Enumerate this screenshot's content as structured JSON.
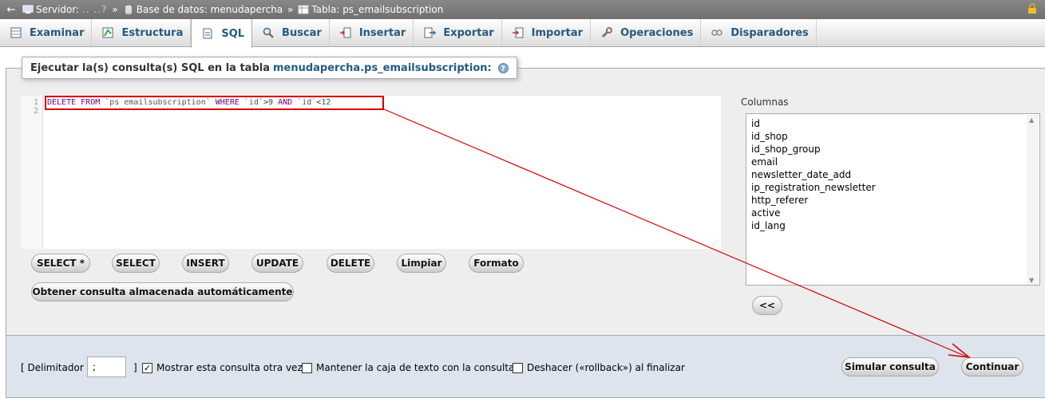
{
  "breadcrumb": {
    "server_label": "Servidor:",
    "server_name": ".. ..?",
    "database_label": "Base de datos: menudapercha",
    "table_label": "Tabla: ps_emailsubscription"
  },
  "tabs": [
    {
      "label": "Examinar",
      "icon": "browse-icon"
    },
    {
      "label": "Estructura",
      "icon": "structure-icon"
    },
    {
      "label": "SQL",
      "icon": "sql-icon",
      "active": true
    },
    {
      "label": "Buscar",
      "icon": "search-icon"
    },
    {
      "label": "Insertar",
      "icon": "insert-icon"
    },
    {
      "label": "Exportar",
      "icon": "export-icon"
    },
    {
      "label": "Importar",
      "icon": "import-icon"
    },
    {
      "label": "Operaciones",
      "icon": "wrench-icon"
    },
    {
      "label": "Disparadores",
      "icon": "triggers-icon"
    }
  ],
  "legend": {
    "prefix": "Ejecutar la(s) consulta(s) SQL en la tabla",
    "table": "menudapercha.ps_emailsubscription:"
  },
  "editor": {
    "line_numbers": [
      "1",
      "2"
    ],
    "query": {
      "kw1": "DELETE",
      "kw2": "FROM",
      "table": "`ps emailsubscription`",
      "kw3": "WHERE",
      "col1": "`id`",
      "op1": ">",
      "num1": "9",
      "kw4": "AND",
      "col2": "`id`",
      "op2": "<",
      "num2": "12"
    }
  },
  "buttons": {
    "select_all": "SELECT *",
    "select": "SELECT",
    "insert": "INSERT",
    "update": "UPDATE",
    "delete": "DELETE",
    "clear": "Limpiar",
    "format": "Formato",
    "get_autosaved": "Obtener consulta almacenada automáticamente",
    "insert_column": "<<",
    "simulate": "Simular consulta",
    "go": "Continuar"
  },
  "columns": {
    "label": "Columnas",
    "items": [
      "id",
      "id_shop",
      "id_shop_group",
      "email",
      "newsletter_date_add",
      "ip_registration_newsletter",
      "http_referer",
      "active",
      "id_lang"
    ]
  },
  "options": {
    "delimiter_prefix": "[ Delimitador",
    "delimiter_value": ";",
    "delimiter_suffix": "]",
    "show_query_again": "Mostrar esta consulta otra vez",
    "show_query_again_checked": true,
    "retain_box": "Mantener la caja de texto con la consulta",
    "retain_box_checked": false,
    "rollback": "Deshacer («rollback») al finalizar",
    "rollback_checked": false
  },
  "colors": {
    "annotation_red": "#d40000",
    "link_blue": "#235a81"
  }
}
